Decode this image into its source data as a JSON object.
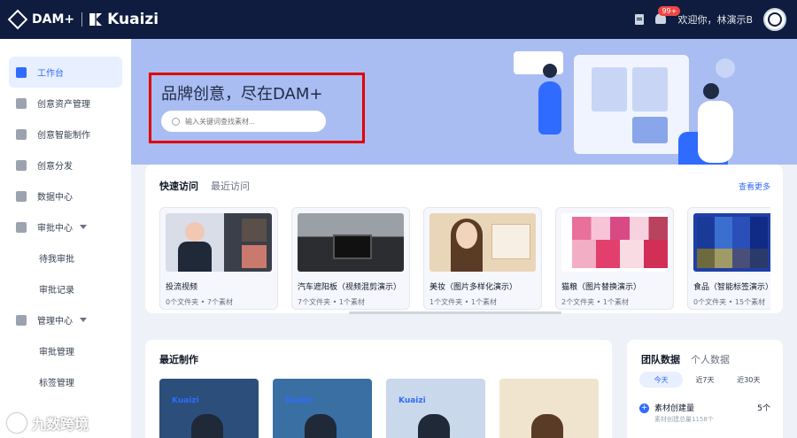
{
  "topbar": {
    "brand": "DAM+",
    "partner": "Kuaizi",
    "badge": "99+",
    "greeting": "欢迎你，林演示B"
  },
  "sidebar": {
    "items": [
      {
        "label": "工作台",
        "icon": "home-icon",
        "active": true
      },
      {
        "label": "创意资产管理",
        "icon": "layers-icon"
      },
      {
        "label": "创意智能制作",
        "icon": "bulb-icon"
      },
      {
        "label": "创意分发",
        "icon": "shield-icon"
      },
      {
        "label": "数据中心",
        "icon": "inbox-icon"
      },
      {
        "label": "审批中心",
        "icon": "approve-icon",
        "expandable": true
      },
      {
        "label": "待我审批",
        "sub": true
      },
      {
        "label": "审批记录",
        "sub": true
      },
      {
        "label": "管理中心",
        "icon": "user-icon",
        "expandable": true
      },
      {
        "label": "审批管理",
        "sub": true
      },
      {
        "label": "标签管理",
        "sub": true
      }
    ]
  },
  "hero": {
    "title": "品牌创意，尽在DAM+",
    "search_placeholder": "输入关键词查找素材..."
  },
  "quick": {
    "tabs": [
      "快速访问",
      "最近访问"
    ],
    "view_more": "查看更多",
    "folders": [
      {
        "name": "投流视频",
        "meta": "0个文件夹 • 7个素材"
      },
      {
        "name": "汽车遮阳板（视频混剪演示）",
        "meta": "7个文件夹 • 1个素材"
      },
      {
        "name": "美妆（图片多样化演示）",
        "meta": "1个文件夹 • 1个素材"
      },
      {
        "name": "猫粮（图片替换演示）",
        "meta": "2个文件夹 • 1个素材"
      },
      {
        "name": "食品（智能标签演示）",
        "meta": "0个文件夹 • 15个素材"
      }
    ]
  },
  "recent": {
    "title": "最近制作",
    "brand_text": "Kuaizi"
  },
  "team": {
    "tabs": [
      "团队数据",
      "个人数据"
    ],
    "periods": [
      "今天",
      "近7天",
      "近30天"
    ],
    "stat": {
      "name": "素材创建量",
      "sub": "素材创建总量1158个",
      "value": "5个"
    }
  },
  "watermark": "九数跨境"
}
